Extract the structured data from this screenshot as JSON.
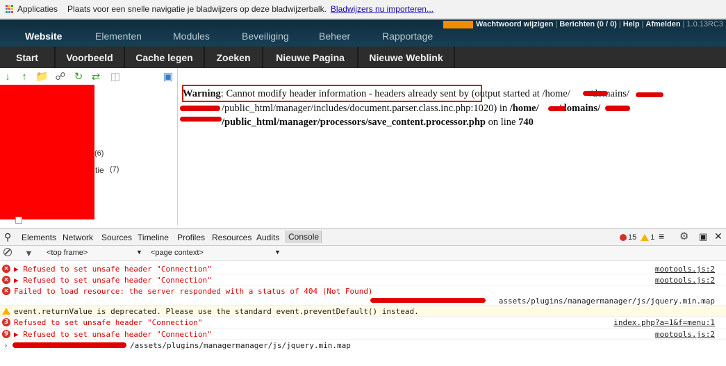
{
  "bookmarks": {
    "apps_label": "Applicaties",
    "placeholder": "Plaats voor een snelle navigatie je bladwijzers op deze bladwijzerbalk.",
    "import_link": "Bladwijzers nu importeren..."
  },
  "top_nav": {
    "tabs": [
      "Website",
      "Elementen",
      "Modules",
      "Beveiliging",
      "Beheer",
      "Rapportage"
    ],
    "account": {
      "change_password": "Wachtwoord wijzigen",
      "messages": "Berichten (0 / 0)",
      "help": "Help",
      "logout": "Afmelden",
      "version": "1.0.13RC3"
    }
  },
  "sub_nav": {
    "buttons": [
      "Start",
      "Voorbeeld",
      "Cache legen",
      "Zoeken",
      "Nieuwe Pagina",
      "Nieuwe Weblink"
    ]
  },
  "tree": {
    "counts": [
      "(6)",
      "tie",
      "(7)"
    ]
  },
  "warning": {
    "label": "Warning",
    "line1": ": Cannot modify header information - headers already sent by (output started at /home/",
    "line1_tail": "/domains/",
    "line2_a": "/public_html/manager/includes/document.parser.class.inc.php:1020) in ",
    "line2_b": "/home/",
    "line2_c": "/domains/",
    "line3": "/public_html/manager/processors/save_content.processor.php",
    "line3_on": " on line ",
    "line3_num": "740"
  },
  "devtools": {
    "tabs": [
      "Elements",
      "Network",
      "Sources",
      "Timeline",
      "Profiles",
      "Resources",
      "Audits",
      "Console"
    ],
    "error_count": "15",
    "warning_count": "1",
    "frame_select": "<top frame>",
    "context_select": "<page context>"
  },
  "console": {
    "rows": [
      {
        "type": "error",
        "text": "Refused to set unsafe header \"Connection\"",
        "source": "mootools.js:2"
      },
      {
        "type": "error",
        "text": "Refused to set unsafe header \"Connection\"",
        "source": "mootools.js:2"
      },
      {
        "type": "error",
        "text": "Failed to load resource: the server responded with a status of 404 (Not Found)",
        "source": "assets/plugins/managermanager/js/jquery.min.map"
      },
      {
        "type": "warning",
        "text": "event.returnValue is deprecated. Please use the standard event.preventDefault() instead.",
        "source": ""
      },
      {
        "type": "error",
        "count": "3",
        "text": "Refused to set unsafe header \"Connection\"",
        "source": "index.php?a=1&f=menu:1"
      },
      {
        "type": "error",
        "count": "9",
        "text": "Refused to set unsafe header \"Connection\"",
        "source": "mootools.js:2"
      }
    ],
    "prompt_text": "/assets/plugins/managermanager/js/jquery.min.map"
  }
}
